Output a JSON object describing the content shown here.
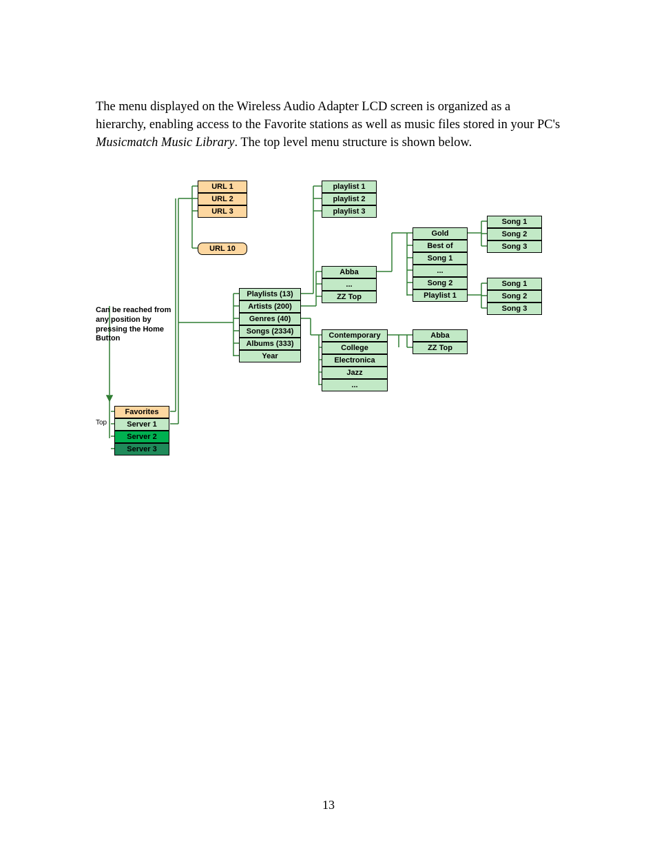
{
  "paragraph": {
    "pre": "The menu displayed on the Wireless Audio Adapter LCD screen is organized as a hierarchy, enabling access to the Favorite stations as well as music files stored in your PC's ",
    "em": "Musicmatch Music Library",
    "post": ". The top level menu structure is shown below."
  },
  "pageNumber": "13",
  "diagram": {
    "topLabel": "Top",
    "note": "Can be reached from any position by pressing the Home Button",
    "urls": [
      "URL 1",
      "URL 2",
      "URL 3",
      "URL 10"
    ],
    "playlists": [
      "playlist 1",
      "playlist 2",
      "playlist 3"
    ],
    "categories": [
      "Playlists (13)",
      "Artists (200)",
      "Genres (40)",
      "Songs (2334)",
      "Albums (333)",
      "Year"
    ],
    "artists": [
      "Abba",
      "...",
      "ZZ Top"
    ],
    "genres": [
      "Contemporary",
      "College",
      "Electronica",
      "Jazz",
      "..."
    ],
    "albums": [
      "Gold",
      "Best of",
      "Song 1",
      "...",
      "Song 2",
      "Playlist 1"
    ],
    "genreArtists": [
      "Abba",
      "ZZ Top"
    ],
    "songsA": [
      "Song 1",
      "Song 2",
      "Song 3"
    ],
    "songsB": [
      "Song 1",
      "Song 2",
      "Song 3"
    ],
    "rootItems": [
      "Favorites",
      "Server 1",
      "Server 2",
      "Server 3"
    ]
  }
}
